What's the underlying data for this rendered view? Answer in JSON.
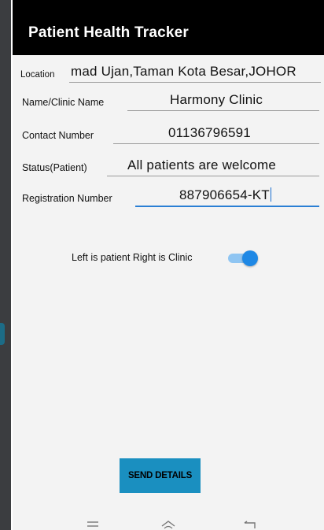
{
  "app": {
    "title": "Patient Health Tracker"
  },
  "form": {
    "location": {
      "label": "Location",
      "value": "mad Ujan,Taman Kota Besar,JOHOR"
    },
    "name": {
      "label": "Name/Clinic Name",
      "value": "Harmony Clinic"
    },
    "contact": {
      "label": "Contact Number",
      "value": "01136796591"
    },
    "status": {
      "label": "Status(Patient)",
      "value": "All patients are welcome"
    },
    "registration": {
      "label": "Registration Number",
      "value": "887906654-KT"
    }
  },
  "toggle": {
    "label": "Left is patient Right is Clinic",
    "state": "on"
  },
  "actions": {
    "send_label": "SEND DETAILS"
  },
  "navbar": {
    "icons": [
      "menu-icon",
      "home-icon",
      "back-icon"
    ]
  },
  "colors": {
    "toolbar": "#000000",
    "accent": "#1e88e5",
    "button": "#1a8fc0"
  }
}
